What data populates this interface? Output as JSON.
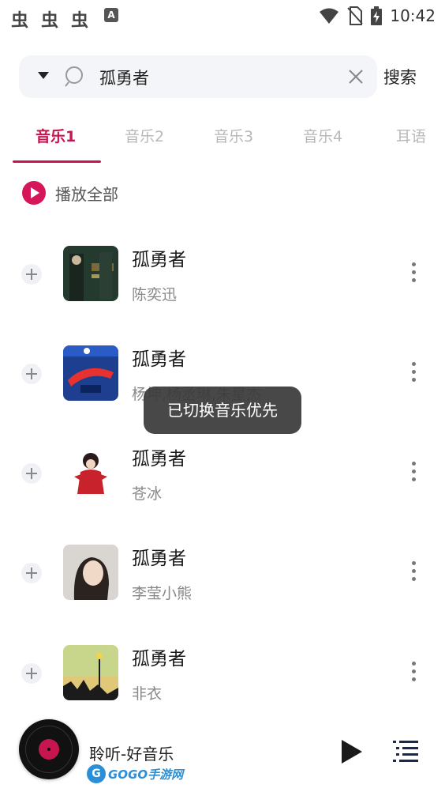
{
  "status_bar": {
    "time": "10:42",
    "notification_glyph": "虫",
    "icons": [
      "bug-icon",
      "bug-icon",
      "bug-icon",
      "a-icon",
      "wifi-icon",
      "no-sim-icon",
      "battery-charging-icon"
    ]
  },
  "search": {
    "query": "孤勇者",
    "button_label": "搜索"
  },
  "tabs": [
    {
      "label": "音乐1",
      "active": true
    },
    {
      "label": "音乐2",
      "active": false
    },
    {
      "label": "音乐3",
      "active": false
    },
    {
      "label": "音乐4",
      "active": false
    },
    {
      "label": "耳语",
      "active": false
    }
  ],
  "play_all": {
    "label": "播放全部"
  },
  "songs": [
    {
      "title": "孤勇者",
      "artist": "陈奕迅"
    },
    {
      "title": "孤勇者",
      "artist": "杨坤,杨丞琳,朱星杰"
    },
    {
      "title": "孤勇者",
      "artist": "苍冰"
    },
    {
      "title": "孤勇者",
      "artist": "李莹小熊"
    },
    {
      "title": "孤勇者",
      "artist": "非衣"
    }
  ],
  "toast": {
    "text": "已切换音乐优先"
  },
  "player": {
    "title": "聆听-好音乐"
  },
  "watermark": {
    "text": "GOGO手游网"
  },
  "colors": {
    "accent": "#c7164f",
    "play_all": "#d6165a",
    "toast_bg": "#3a3a3a"
  }
}
